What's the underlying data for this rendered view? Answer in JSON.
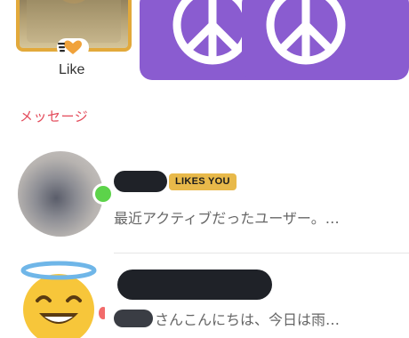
{
  "likes_row": {
    "like_label": "Like"
  },
  "messages_section": {
    "title": "メッセージ"
  },
  "conversations": [
    {
      "badge": "LIKES YOU",
      "preview": "最近アクティブだったユーザー。…",
      "online": true
    },
    {
      "preview": "さんこんにちは、今日は雨…"
    }
  ],
  "colors": {
    "accent": "#e34a5a",
    "like_border": "#e2a93b",
    "peace_tile": "#8a5cd0",
    "badge_bg": "#e8b94a",
    "online": "#5cd34a"
  },
  "icons": [
    "heart-arrow-icon",
    "peace-sign-icon",
    "smiling-face-with-halo-icon"
  ]
}
